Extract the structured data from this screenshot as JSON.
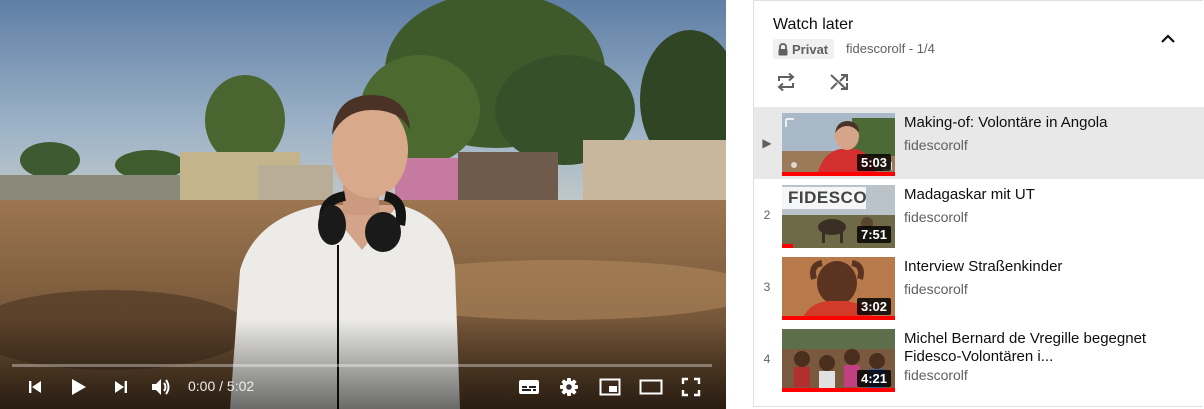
{
  "player": {
    "time_current": "0:00",
    "time_separator": " / ",
    "time_total": "5:02",
    "progress_fraction": 0,
    "buttons": [
      "previous-icon",
      "play-icon",
      "next-icon",
      "volume-icon",
      "subtitles-icon",
      "settings-icon",
      "miniplayer-icon",
      "theater-icon",
      "fullscreen-icon"
    ]
  },
  "playlist": {
    "title": "Watch later",
    "privacy": "Privat",
    "meta": "fidescorolf - 1/4",
    "icons": {
      "privacy": "lock-icon",
      "collapse": "chevron-up-icon",
      "loop": "loop-icon",
      "shuffle": "shuffle-icon"
    },
    "items": [
      {
        "index": "▶",
        "title": "Making-of: Volontäre in Angola",
        "channel": "fidescorolf",
        "duration": "5:03",
        "active": true,
        "watched_fraction": 1.0
      },
      {
        "index": "2",
        "title": "Madagaskar mit UT",
        "channel": "fidescorolf",
        "duration": "7:51",
        "active": false,
        "watched_fraction": 0.1
      },
      {
        "index": "3",
        "title": "Interview Straßenkinder",
        "channel": "fidescorolf",
        "duration": "3:02",
        "active": false,
        "watched_fraction": 1.0
      },
      {
        "index": "4",
        "title": "Michel Bernard de Vregille begegnet Fidesco-Volontären i...",
        "channel": "fidescorolf",
        "duration": "4:21",
        "active": false,
        "watched_fraction": 1.0
      }
    ],
    "thumb_text": "FIDESCO"
  },
  "colors": {
    "accent": "#ff0000",
    "panel_active": "#e8e8e8",
    "secondary_text": "#606060"
  }
}
